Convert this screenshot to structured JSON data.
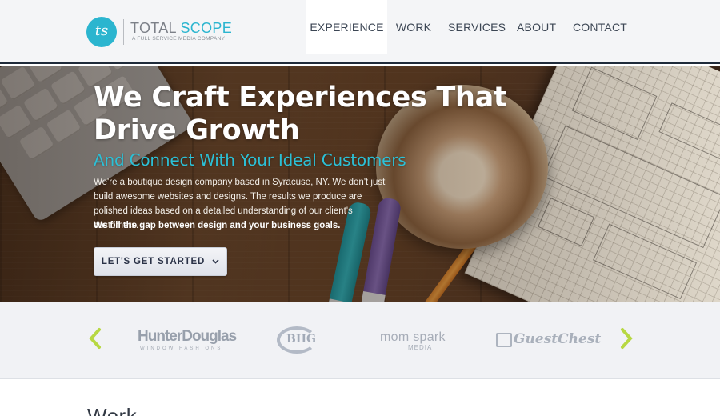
{
  "header": {
    "logo_monogram": "ts",
    "logo_word_1": "TOTAL",
    "logo_word_2": "SCOPE",
    "logo_tagline": "A FULL SERVICE MEDIA COMPANY",
    "nav": [
      {
        "label": "EXPERIENCE",
        "active": true
      },
      {
        "label": "WORK",
        "active": false
      },
      {
        "label": "SERVICES",
        "active": false
      },
      {
        "label": "ABOUT",
        "active": false
      },
      {
        "label": "CONTACT",
        "active": false
      }
    ]
  },
  "hero": {
    "title": "We Craft Experiences That Drive Growth",
    "subtitle": "And Connect With Your Ideal Customers",
    "body": "We're a boutique design company based in Syracuse, NY. We don't just build awesome websites and designs. The results we produce are polished ideas based on a detailed understanding of our client's customers.",
    "tagline": "We fill the gap between design and your business goals.",
    "cta_label": "LET'S GET STARTED",
    "cta_icon": "chevron-down-icon"
  },
  "clients": {
    "prev_icon": "chevron-left-icon",
    "next_icon": "chevron-right-icon",
    "accent_color": "#b7d842",
    "logos": [
      {
        "name": "HunterDouglas",
        "sub": "WINDOW FASHIONS"
      },
      {
        "name": "BHG"
      },
      {
        "name": "mom spark",
        "sub": "MEDIA"
      },
      {
        "name": "GuestChest"
      }
    ]
  },
  "work": {
    "heading": "Work"
  },
  "colors": {
    "brand_teal": "#2bb5cf",
    "header_bg": "#f4f5f7",
    "header_border": "#1f2b3a"
  }
}
